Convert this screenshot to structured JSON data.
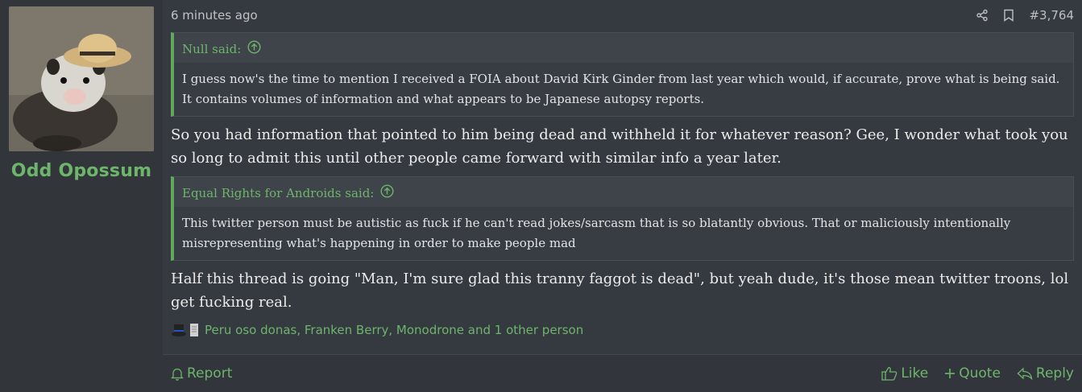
{
  "user": {
    "username": "Odd Opossum",
    "avatar_icon": "opossum-with-straw-hat-avatar"
  },
  "post": {
    "timestamp": "6 minutes ago",
    "post_number": "#3,764"
  },
  "quotes": [
    {
      "author_line": "Null said:",
      "text": "I guess now's the time to mention I received a FOIA about David Kirk Ginder from last year which would, if accurate, prove what is being said. It contains volumes of information and what appears to be Japanese autopsy reports."
    },
    {
      "author_line": "Equal Rights for Androids said:",
      "text": "This twitter person must be autistic as fuck if he can't read jokes/sarcasm that is so blatantly obvious. That or maliciously intentionally misrepresenting what's happening in order to make people mad"
    }
  ],
  "replies": [
    "So you had information that pointed to him being dead and withheld it for whatever reason? Gee, I wonder what took you so long to admit this until other people came forward with similar info a year later.",
    "Half this thread is going \"Man, I'm sure glad this tranny faggot is dead\", but yeah dude, it's those mean twitter troons, lol get fucking real."
  ],
  "reactions": {
    "text": "Peru oso donas, Franken Berry, Monodrone and 1 other person"
  },
  "actions": {
    "report": "Report",
    "like": "Like",
    "quote": "Quote",
    "reply": "Reply"
  },
  "colors": {
    "accent_green": "#6db56b",
    "background": "#353940"
  }
}
